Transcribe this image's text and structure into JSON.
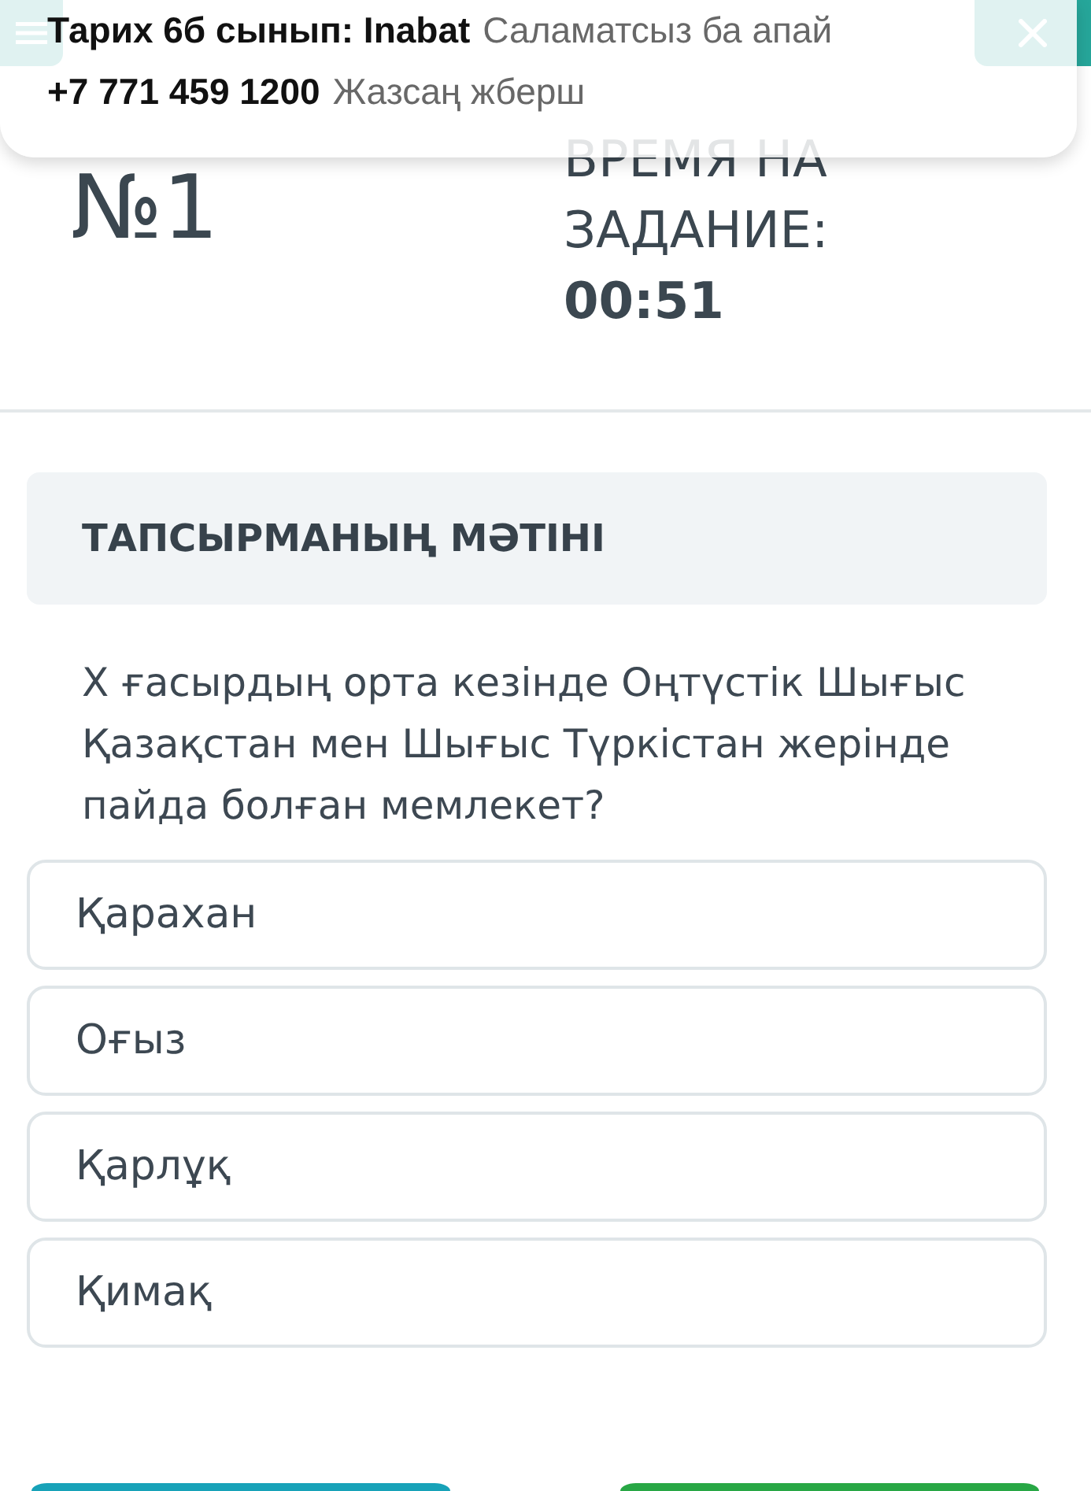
{
  "header": {
    "task_number": "№1",
    "timer_label": "ВРЕМЯ НА ЗАДАНИЕ:",
    "timer_value": "00:51"
  },
  "notification": {
    "lines": [
      {
        "sender": "Тарих 6б сынып: Inabat",
        "message": "Саламатсыз ба апай"
      },
      {
        "sender": "+7 771 459 1200",
        "message": "Жазсаң жберш"
      }
    ]
  },
  "task_text": {
    "heading": "ТАПСЫРМАНЫҢ МӘТІНІ",
    "question": "X ғасырдың орта кезінде Оңтүстік Шығыс Қазақстан мен Шығыс Түркістан жерінде пайда болған мемлекет?"
  },
  "options": [
    {
      "label": "Қарахан",
      "selected": false
    },
    {
      "label": "Оғыз",
      "selected": false
    },
    {
      "label": "Қарлұқ",
      "selected": false
    },
    {
      "label": "Қимақ",
      "selected": false
    }
  ],
  "footer_buttons": [
    {
      "kind": "secondary"
    },
    {
      "kind": "primary"
    }
  ]
}
